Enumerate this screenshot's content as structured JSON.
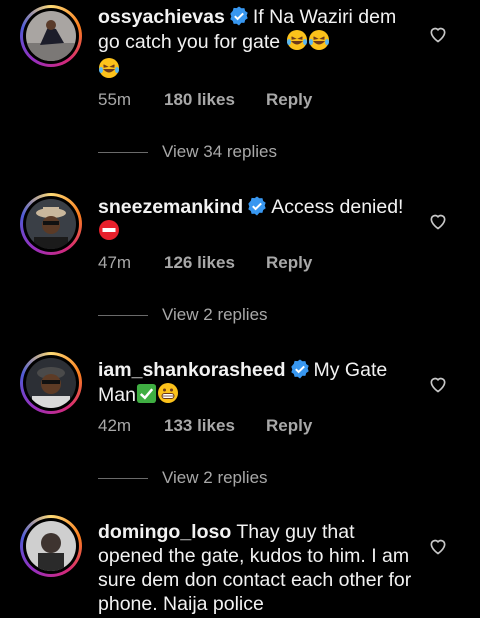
{
  "comments": [
    {
      "username": "ossyachievas",
      "verified": true,
      "text": "If Na Waziri dem go catch you for gate",
      "emojis": [
        "laughing-tears",
        "laughing-tears",
        "laughing-tears"
      ],
      "time": "55m",
      "likes": "180 likes",
      "reply_label": "Reply",
      "view_replies": "View 34 replies"
    },
    {
      "username": "sneezemankind",
      "verified": true,
      "text": "Access denied!",
      "emojis": [
        "no-entry"
      ],
      "time": "47m",
      "likes": "126 likes",
      "reply_label": "Reply",
      "view_replies": "View 2 replies"
    },
    {
      "username": "iam_shankorasheed",
      "verified": true,
      "text": "My Gate Man",
      "emojis": [
        "check-mark",
        "grin"
      ],
      "time": "42m",
      "likes": "133 likes",
      "reply_label": "Reply",
      "view_replies": "View 2 replies"
    },
    {
      "username": "domingo_loso",
      "verified": false,
      "text": "Thay guy that opened the gate, kudos to him. I am sure dem don contact each other for phone. Naija police"
    }
  ]
}
